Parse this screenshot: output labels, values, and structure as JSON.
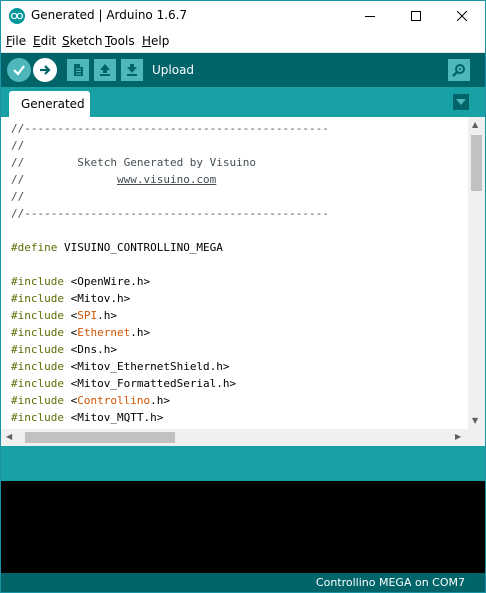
{
  "window": {
    "title": "Generated | Arduino 1.6.7",
    "minimize_glyph": "—",
    "maximize_glyph": "☐",
    "close_glyph": "✕"
  },
  "menu": {
    "items": [
      {
        "key": "F",
        "rest": "ile"
      },
      {
        "key": "E",
        "rest": "dit"
      },
      {
        "key": "S",
        "rest": "ketch"
      },
      {
        "key": "T",
        "rest": "ools"
      },
      {
        "key": "H",
        "rest": "elp"
      }
    ]
  },
  "toolbar": {
    "hover_label": "Upload",
    "buttons": [
      "verify-icon",
      "upload-icon",
      "new-icon",
      "open-icon",
      "save-icon"
    ],
    "serial_monitor_icon": "magnifier-icon"
  },
  "tabs": [
    {
      "label": "Generated"
    }
  ],
  "editor": {
    "lines": [
      {
        "parts": [
          {
            "t": "//----------------------------------------------",
            "c": "comment"
          }
        ]
      },
      {
        "parts": [
          {
            "t": "//",
            "c": "comment"
          }
        ]
      },
      {
        "parts": [
          {
            "t": "//        Sketch Generated by Visuino",
            "c": "comment"
          }
        ]
      },
      {
        "parts": [
          {
            "t": "//              ",
            "c": "comment"
          },
          {
            "t": "www.visuino.com",
            "c": "link"
          }
        ]
      },
      {
        "parts": [
          {
            "t": "//",
            "c": "comment"
          }
        ]
      },
      {
        "parts": [
          {
            "t": "//----------------------------------------------",
            "c": "comment"
          }
        ]
      },
      {
        "parts": []
      },
      {
        "parts": [
          {
            "t": "#define",
            "c": "kw"
          },
          {
            "t": " VISUINO_CONTROLLINO_MEGA",
            "c": "plain"
          }
        ]
      },
      {
        "parts": []
      },
      {
        "parts": [
          {
            "t": "#include",
            "c": "kw"
          },
          {
            "t": " <OpenWire.h>",
            "c": "plain"
          }
        ]
      },
      {
        "parts": [
          {
            "t": "#include",
            "c": "kw"
          },
          {
            "t": " <Mitov.h>",
            "c": "plain"
          }
        ]
      },
      {
        "parts": [
          {
            "t": "#include",
            "c": "kw"
          },
          {
            "t": " <",
            "c": "plain"
          },
          {
            "t": "SPI",
            "c": "orange"
          },
          {
            "t": ".h>",
            "c": "plain"
          }
        ]
      },
      {
        "parts": [
          {
            "t": "#include",
            "c": "kw"
          },
          {
            "t": " <",
            "c": "plain"
          },
          {
            "t": "Ethernet",
            "c": "orange"
          },
          {
            "t": ".h>",
            "c": "plain"
          }
        ]
      },
      {
        "parts": [
          {
            "t": "#include",
            "c": "kw"
          },
          {
            "t": " <Dns.h>",
            "c": "plain"
          }
        ]
      },
      {
        "parts": [
          {
            "t": "#include",
            "c": "kw"
          },
          {
            "t": " <Mitov_EthernetShield.h>",
            "c": "plain"
          }
        ]
      },
      {
        "parts": [
          {
            "t": "#include",
            "c": "kw"
          },
          {
            "t": " <Mitov_FormattedSerial.h>",
            "c": "plain"
          }
        ]
      },
      {
        "parts": [
          {
            "t": "#include",
            "c": "kw"
          },
          {
            "t": " <",
            "c": "plain"
          },
          {
            "t": "Controllino",
            "c": "orange"
          },
          {
            "t": ".h>",
            "c": "plain"
          }
        ]
      },
      {
        "parts": [
          {
            "t": "#include",
            "c": "kw"
          },
          {
            "t": " <Mitov_MQTT.h>",
            "c": "plain"
          }
        ]
      }
    ]
  },
  "status": {
    "board": "Controllino MEGA on COM7"
  },
  "colors": {
    "teal_dark": "#006468",
    "teal_mid": "#17a1a5",
    "teal_light": "#4db7bb",
    "comment": "#434f54",
    "keyword": "#5e6d03",
    "library": "#d35400"
  }
}
